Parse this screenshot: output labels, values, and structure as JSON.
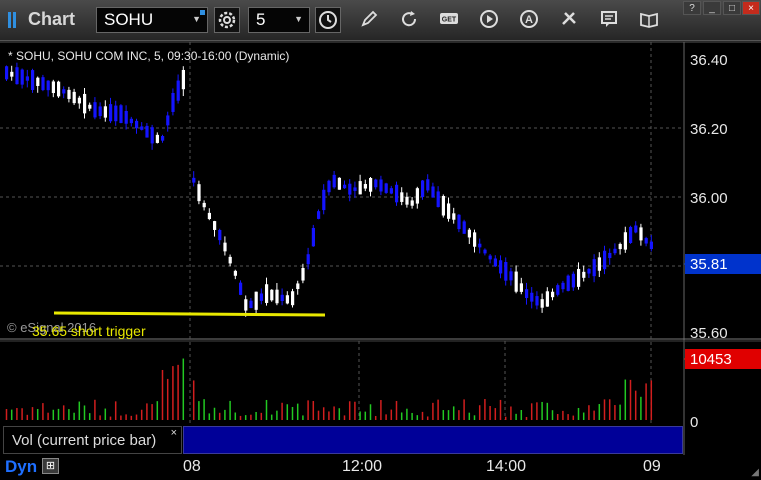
{
  "app": {
    "title": "Chart"
  },
  "toolbar": {
    "symbol": "SOHU",
    "interval": "5",
    "icons": [
      "gear-icon",
      "clock-icon",
      "pencil-icon",
      "refresh-icon",
      "get-icon",
      "play-icon",
      "alert-icon",
      "tools-icon",
      "comment-icon",
      "book-icon"
    ],
    "get_label": "GET",
    "alert_label": "A"
  },
  "chart": {
    "header": "* SOHU, SOHU COM INC, 5, 09:30-16:00 (Dynamic)",
    "watermark": "© eSignal 2016",
    "annotation": "35.65 short trigger",
    "price_ticks": [
      "36.40",
      "36.20",
      "36.00",
      "35.60"
    ],
    "last_price": "35.81",
    "last_volume": "10453",
    "volume_zero": "0",
    "time_labels": [
      "08",
      "12:00",
      "14:00",
      "09"
    ],
    "study_label": "Vol (current price bar)",
    "study_close": "×",
    "dyn_label": "Dyn",
    "colors": {
      "up": "#ffffff",
      "down": "#1414ff",
      "vol_up": "#22c922",
      "vol_down": "#d21e1e",
      "trigger": "#e8e800",
      "last": "#0033cc",
      "vol_tag": "#e00000"
    }
  },
  "window": {
    "minimize": "_",
    "maximize": "□",
    "close": "×",
    "help": "?"
  }
}
